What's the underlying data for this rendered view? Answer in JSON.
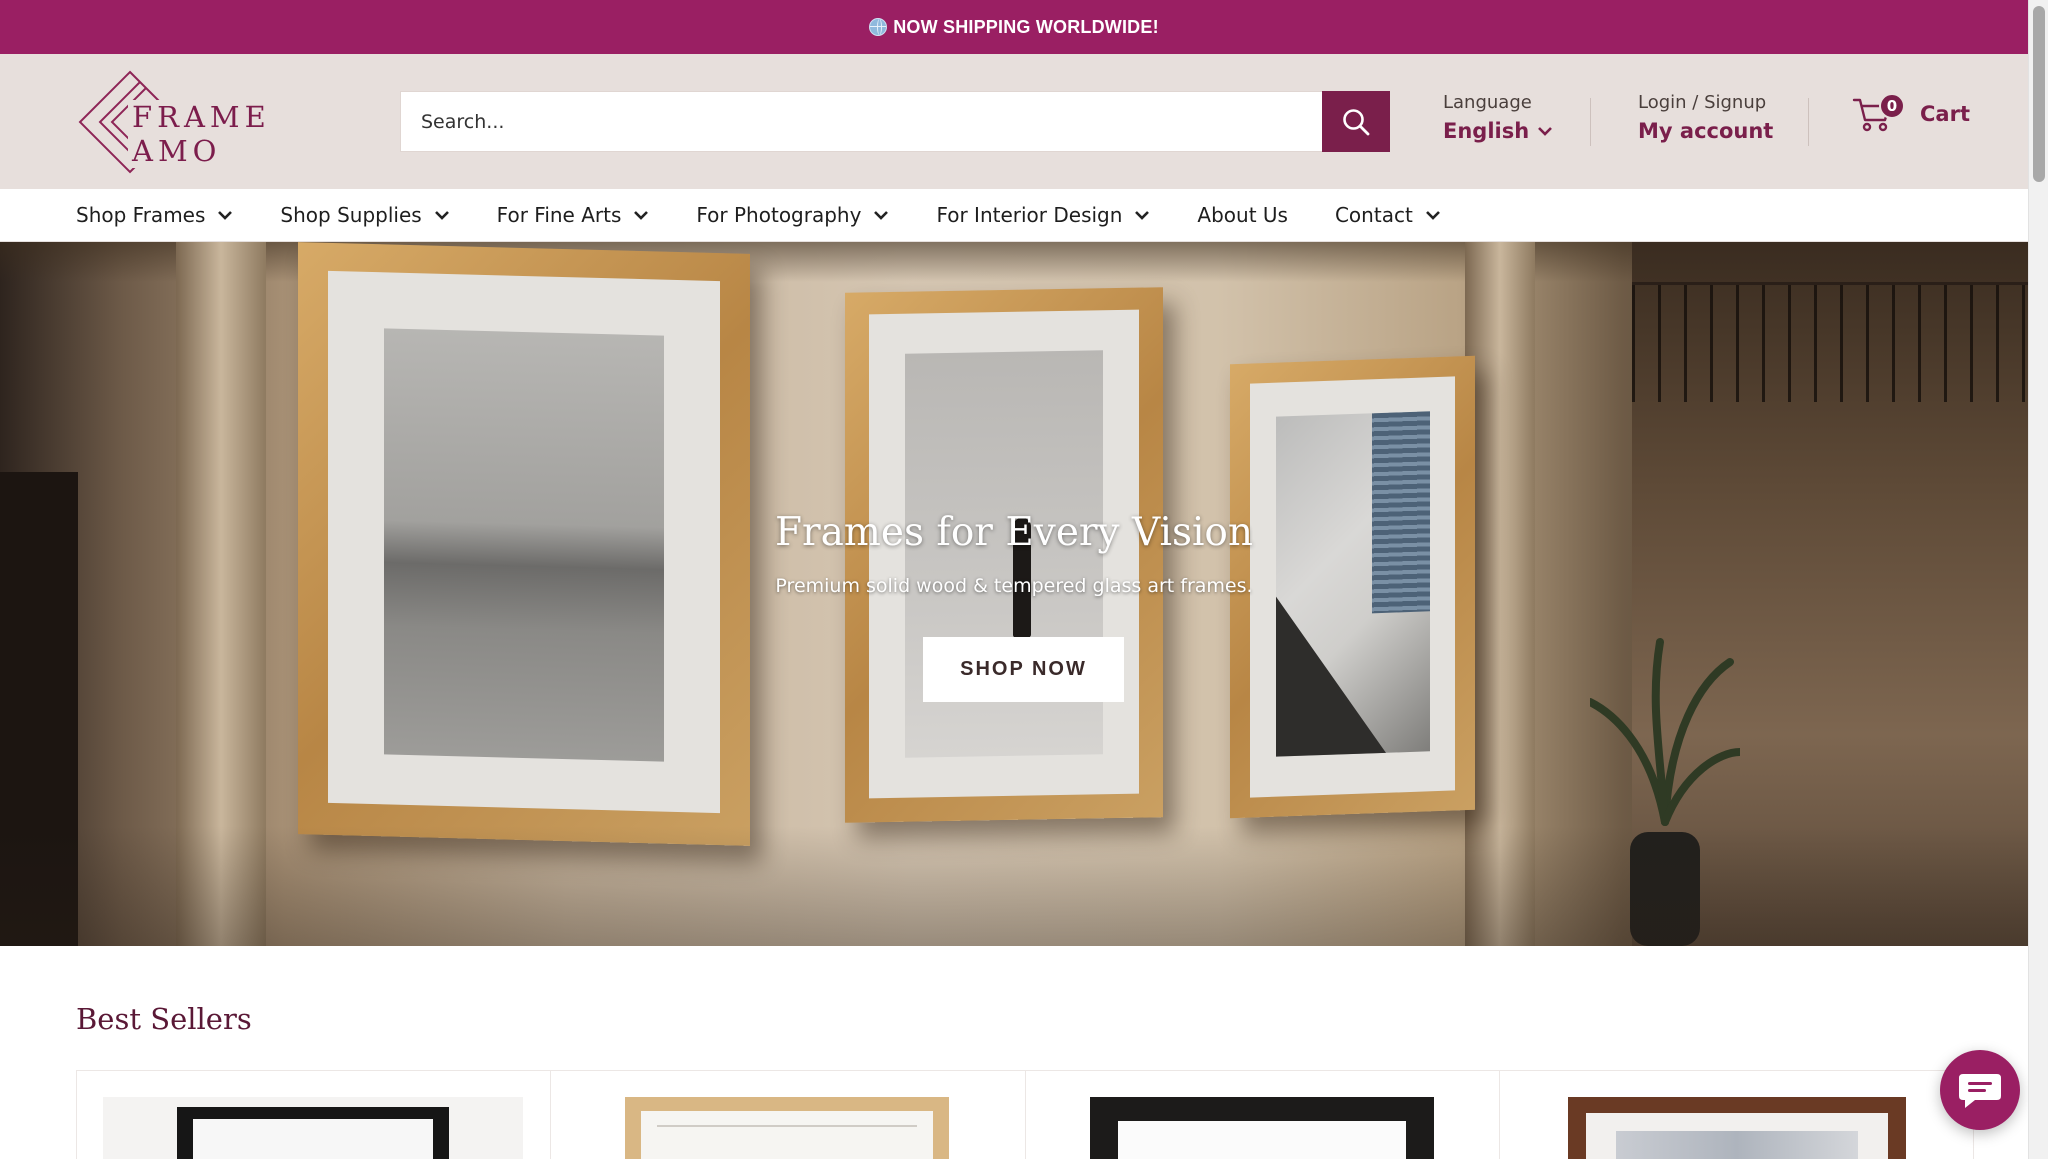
{
  "announcement": {
    "text": "NOW SHIPPING WORLDWIDE!",
    "icon": "globe-icon"
  },
  "brand": {
    "name": "FRAME AMO",
    "color": "#7a1f4b",
    "announce_color": "#9a1f63"
  },
  "search": {
    "placeholder": "Search...",
    "value": ""
  },
  "language": {
    "label": "Language",
    "value": "English"
  },
  "account": {
    "label": "Login / Signup",
    "link": "My account"
  },
  "cart": {
    "count": "0",
    "label": "Cart"
  },
  "nav": {
    "items": [
      {
        "label": "Shop Frames",
        "has_dropdown": true
      },
      {
        "label": "Shop Supplies",
        "has_dropdown": true
      },
      {
        "label": "For Fine Arts",
        "has_dropdown": true
      },
      {
        "label": "For Photography",
        "has_dropdown": true
      },
      {
        "label": "For Interior Design",
        "has_dropdown": true
      },
      {
        "label": "About Us",
        "has_dropdown": false
      },
      {
        "label": "Contact",
        "has_dropdown": true
      }
    ]
  },
  "hero": {
    "title": "Frames for Every Vision",
    "subtitle": "Premium solid wood & tempered glass art frames.",
    "cta": "SHOP NOW"
  },
  "best_sellers": {
    "title": "Best Sellers",
    "products": [
      {
        "frame_color": "black"
      },
      {
        "frame_color": "natural wood"
      },
      {
        "frame_color": "black"
      },
      {
        "frame_color": "walnut"
      }
    ]
  },
  "chat": {
    "icon": "chat-bubble-icon"
  }
}
